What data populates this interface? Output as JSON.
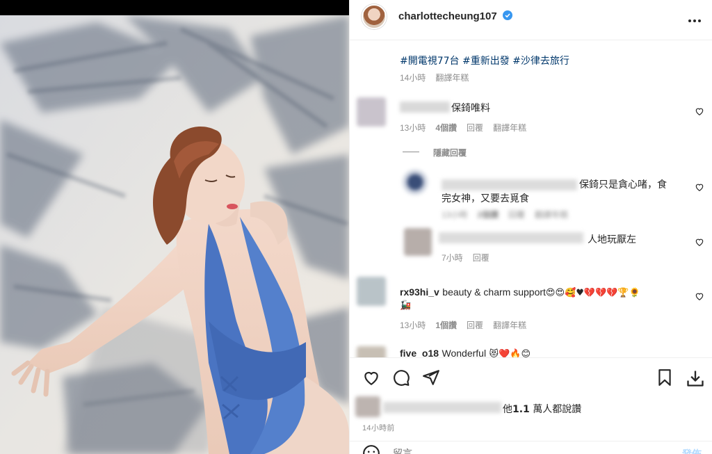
{
  "post": {
    "username": "charlottecheung107",
    "caption_hashtags": "#開電視77台 #重新出發 #沙律去旅行",
    "caption_time": "14小時",
    "caption_translate": "翻譯年糕",
    "more_icon": "more-horizontal-icon",
    "verified_icon": "verified-badge-icon"
  },
  "comments": [
    {
      "text": "保錡唯料",
      "time": "13小時",
      "likes": "4個讚",
      "reply": "回覆",
      "translate": "翻譯年糕",
      "hide_replies": "隱藏回覆"
    },
    {
      "text_line1": "保錡只是貪心啫，食",
      "text_line2": "完女神，又要去覓食",
      "time": "13小時",
      "likes": "2個讚",
      "reply": "回覆",
      "translate": "翻譯年糕"
    },
    {
      "text": "人地玩厭左",
      "time": "7小時",
      "reply": "回覆"
    },
    {
      "username": "rx93hi_v",
      "text": "beauty & charm support",
      "emojis": "😍😍🥰♥💔💔💔🏆🌻",
      "extra_emoji": "🚂",
      "time": "13小時",
      "likes": "1個讚",
      "reply": "回覆",
      "translate": "翻譯年糕"
    },
    {
      "username": "five_o18",
      "text": "Wonderful",
      "emojis": "😻❤️🔥😊"
    }
  ],
  "actions": {
    "like_icon": "heart-icon",
    "comment_icon": "comment-icon",
    "share_icon": "share-icon",
    "save_icon": "bookmark-icon",
    "download_icon": "download-icon"
  },
  "likes_summary": {
    "prefix": "他",
    "count": "1.1",
    "suffix": " 萬人都說讚"
  },
  "post_time": "14小時前",
  "comment_box": {
    "emoji_icon": "emoji-icon",
    "placeholder": "留言",
    "post_label": "發佈"
  },
  "colors": {
    "verified": "#3897f0",
    "link": "#00376b",
    "muted": "#8e8e8e",
    "post_disabled": "#b3dbff"
  }
}
